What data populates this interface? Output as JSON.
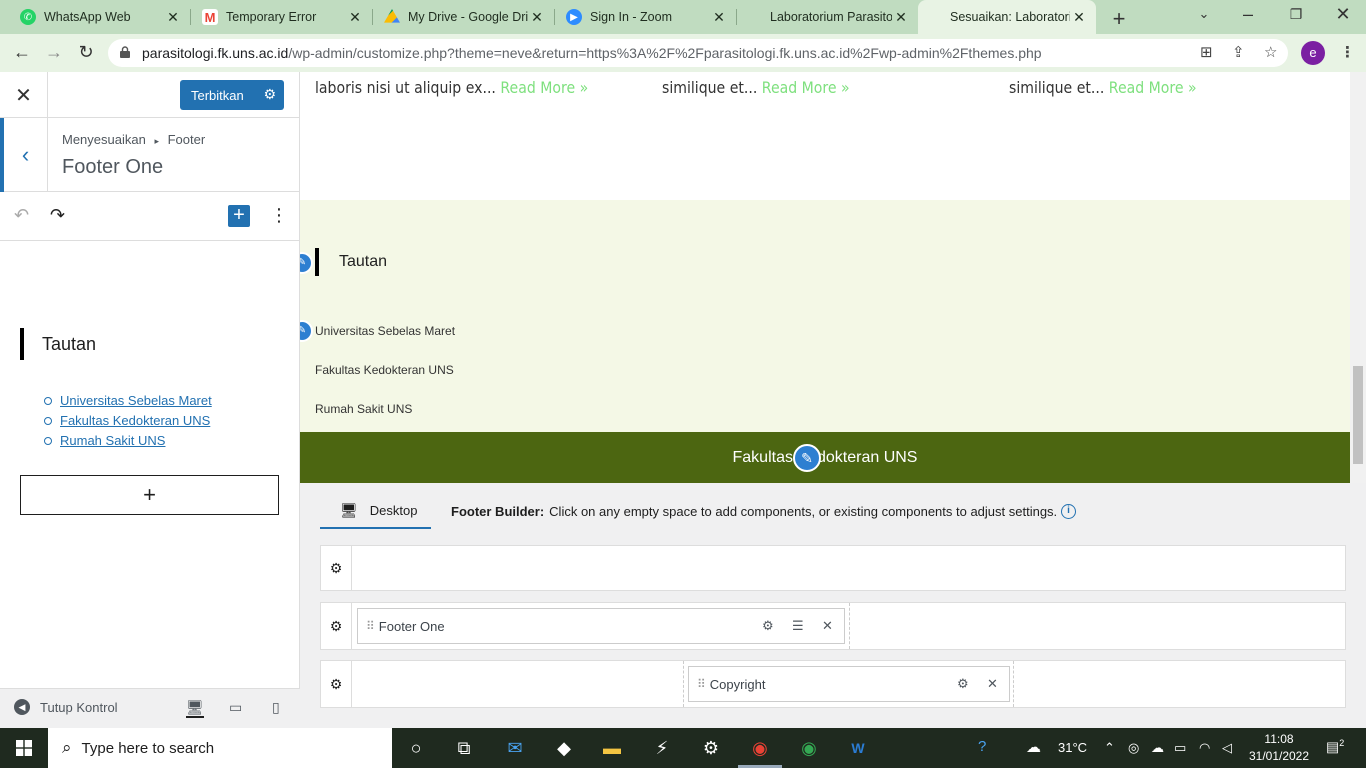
{
  "browser": {
    "tabs": [
      {
        "title": "WhatsApp Web",
        "favicon": "whatsapp-icon",
        "color": "#25d366"
      },
      {
        "title": "Temporary Error",
        "favicon": "gmail-icon",
        "color": "#ea4335"
      },
      {
        "title": "My Drive - Google Drive",
        "favicon": "drive-icon",
        "color": "#fbbc04"
      },
      {
        "title": "Sign In - Zoom",
        "favicon": "zoom-icon",
        "color": "#2d8cff"
      },
      {
        "title": "Laboratorium Parasitologi",
        "favicon": "globe-icon",
        "color": ""
      },
      {
        "title": "Sesuaikan: Laboratorium",
        "favicon": "globe-icon",
        "color": ""
      }
    ],
    "url_host": "parasitologi.fk.uns.ac.id",
    "url_path": "/wp-admin/customize.php?theme=neve&return=https%3A%2F%2Fparasitologi.fk.uns.ac.id%2Fwp-admin%2Fthemes.php",
    "profile_initial": "e"
  },
  "sidebar": {
    "publish_label": "Terbitkan",
    "breadcrumb_parent": "Menyesuaikan",
    "breadcrumb_child": "Footer",
    "panel_title": "Footer One",
    "heading": "Tautan",
    "links": [
      "Universitas Sebelas Maret",
      "Fakultas Kedokteran UNS",
      "Rumah Sakit UNS"
    ],
    "add_label": "+",
    "hide_controls_label": "Tutup Kontrol"
  },
  "preview": {
    "excerpts": [
      {
        "text": "laboris nisi ut aliquip ex...",
        "more": "Read More »"
      },
      {
        "text": "similique et...",
        "more": "Read More »"
      },
      {
        "text": "similique et...",
        "more": "Read More »"
      }
    ],
    "footer_heading": "Tautan",
    "footer_links": [
      "Universitas Sebelas Maret",
      "Fakultas Kedokteran UNS",
      "Rumah Sakit UNS"
    ],
    "copyright_text": "Fakultas Kedokteran UNS",
    "colors": {
      "footer_bg": "#f4f8e6",
      "copyright_bg": "#4c6611",
      "read_more": "#7ee07e"
    }
  },
  "builder": {
    "device_tab": "Desktop",
    "info_label": "Footer Builder:",
    "info_text": "Click on any empty space to add components, or existing components to adjust settings.",
    "components": {
      "footer_one": "Footer One",
      "copyright": "Copyright"
    }
  },
  "taskbar": {
    "search_placeholder": "Type here to search",
    "temperature": "31°C",
    "time": "11:08",
    "date": "31/01/2022",
    "notifications": "2"
  }
}
